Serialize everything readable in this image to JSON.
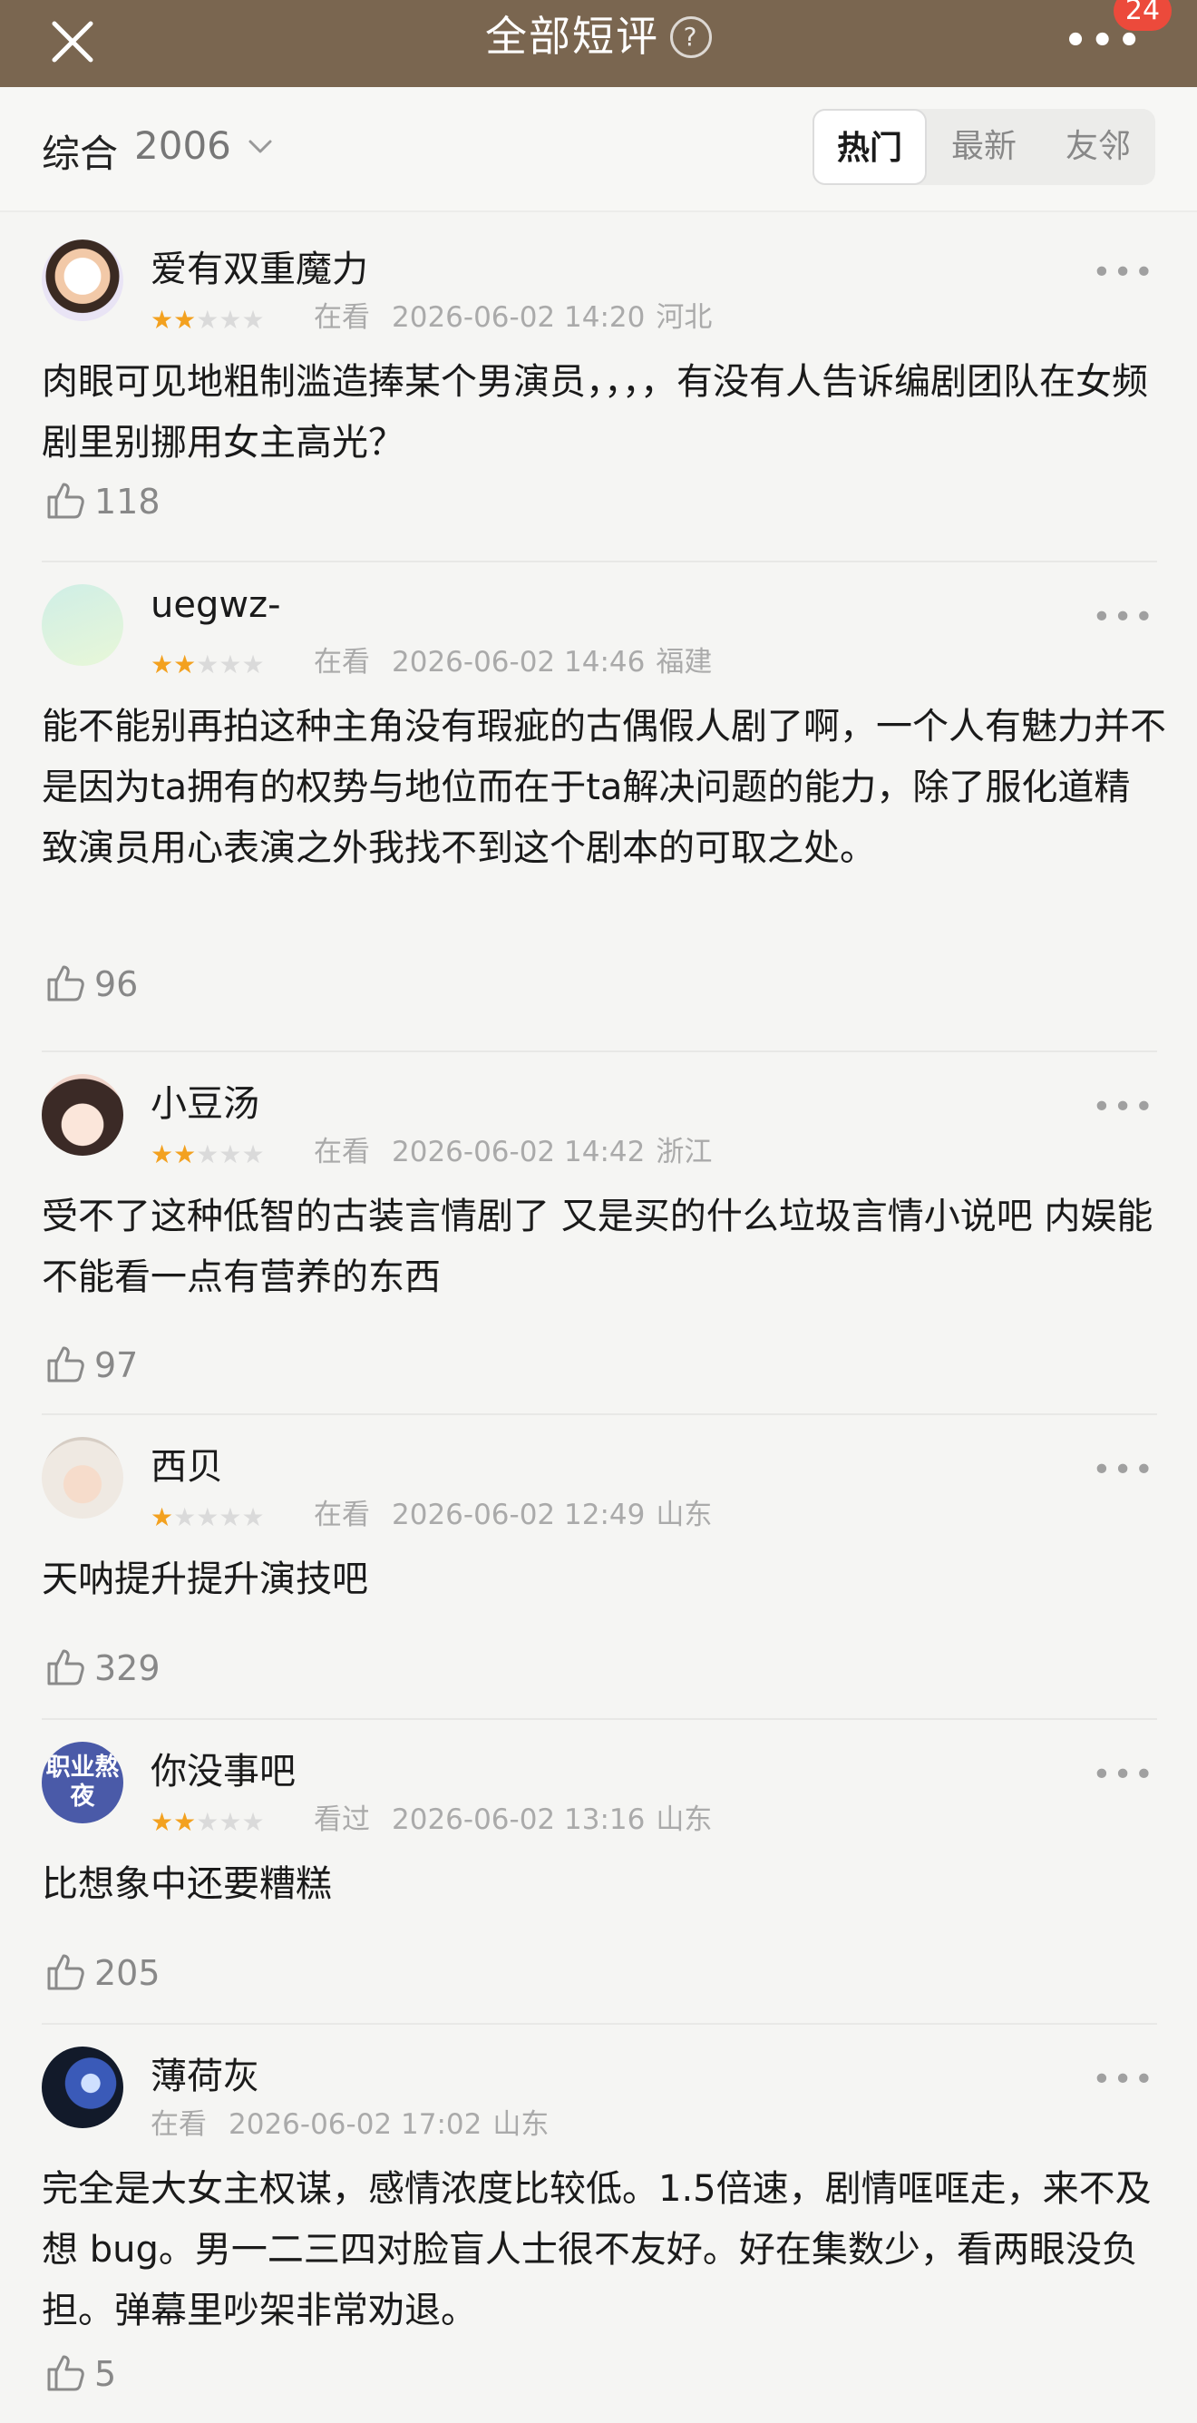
{
  "header": {
    "title": "全部短评",
    "help_icon": "?",
    "more_icon": "•••",
    "badge_count": "24"
  },
  "filter": {
    "sort_label": "综合",
    "count": "2006",
    "tabs": [
      {
        "label": "热门",
        "active": true
      },
      {
        "label": "最新",
        "active": false
      },
      {
        "label": "友邻",
        "active": false
      }
    ]
  },
  "reviews": [
    {
      "user": "爱有双重魔力",
      "rating": 2,
      "status": "在看",
      "datetime": "2026-06-02 14:20",
      "location": "河北",
      "text": "肉眼可见地粗制滥造捧某个男演员，，，，有没有人告诉编剧团队在女频剧里别挪用女主高光？",
      "likes": "118"
    },
    {
      "user": "uegwz-",
      "rating": 2,
      "status": "在看",
      "datetime": "2026-06-02 14:46",
      "location": "福建",
      "text": "能不能别再拍这种主角没有瑕疵的古偶假人剧了啊，一个人有魅力并不是因为ta拥有的权势与地位而在于ta解决问题的能力，除了服化道精致演员用心表演之外我找不到这个剧本的可取之处。",
      "likes": "96"
    },
    {
      "user": "小豆汤",
      "rating": 2,
      "status": "在看",
      "datetime": "2026-06-02 14:42",
      "location": "浙江",
      "text": "受不了这种低智的古装言情剧了 又是买的什么垃圾言情小说吧 内娱能不能看一点有营养的东西",
      "likes": "97"
    },
    {
      "user": "西贝",
      "rating": 1,
      "status": "在看",
      "datetime": "2026-06-02 12:49",
      "location": "山东",
      "text": "天呐提升提升演技吧",
      "likes": "329"
    },
    {
      "user": "你没事吧",
      "rating": 2,
      "status": "看过",
      "datetime": "2026-06-02 13:16",
      "location": "山东",
      "avatar_text": "职业熬夜",
      "text": "比想象中还要糟糕",
      "likes": "205"
    },
    {
      "user": "薄荷灰",
      "rating": 0,
      "status": "在看",
      "datetime": "2026-06-02 17:02",
      "location": "山东",
      "text": "完全是大女主权谋，感情浓度比较低。1.5倍速，剧情哐哐走，来不及想 bug。男一二三四对脸盲人士很不友好。好在集数少，看两眼没负担。弹幕里吵架非常劝退。",
      "likes": "5"
    }
  ],
  "colors": {
    "header_bg": "#7a6650",
    "star_on": "#f3a11f",
    "star_off": "#dadada",
    "badge": "#ec4a3b"
  }
}
